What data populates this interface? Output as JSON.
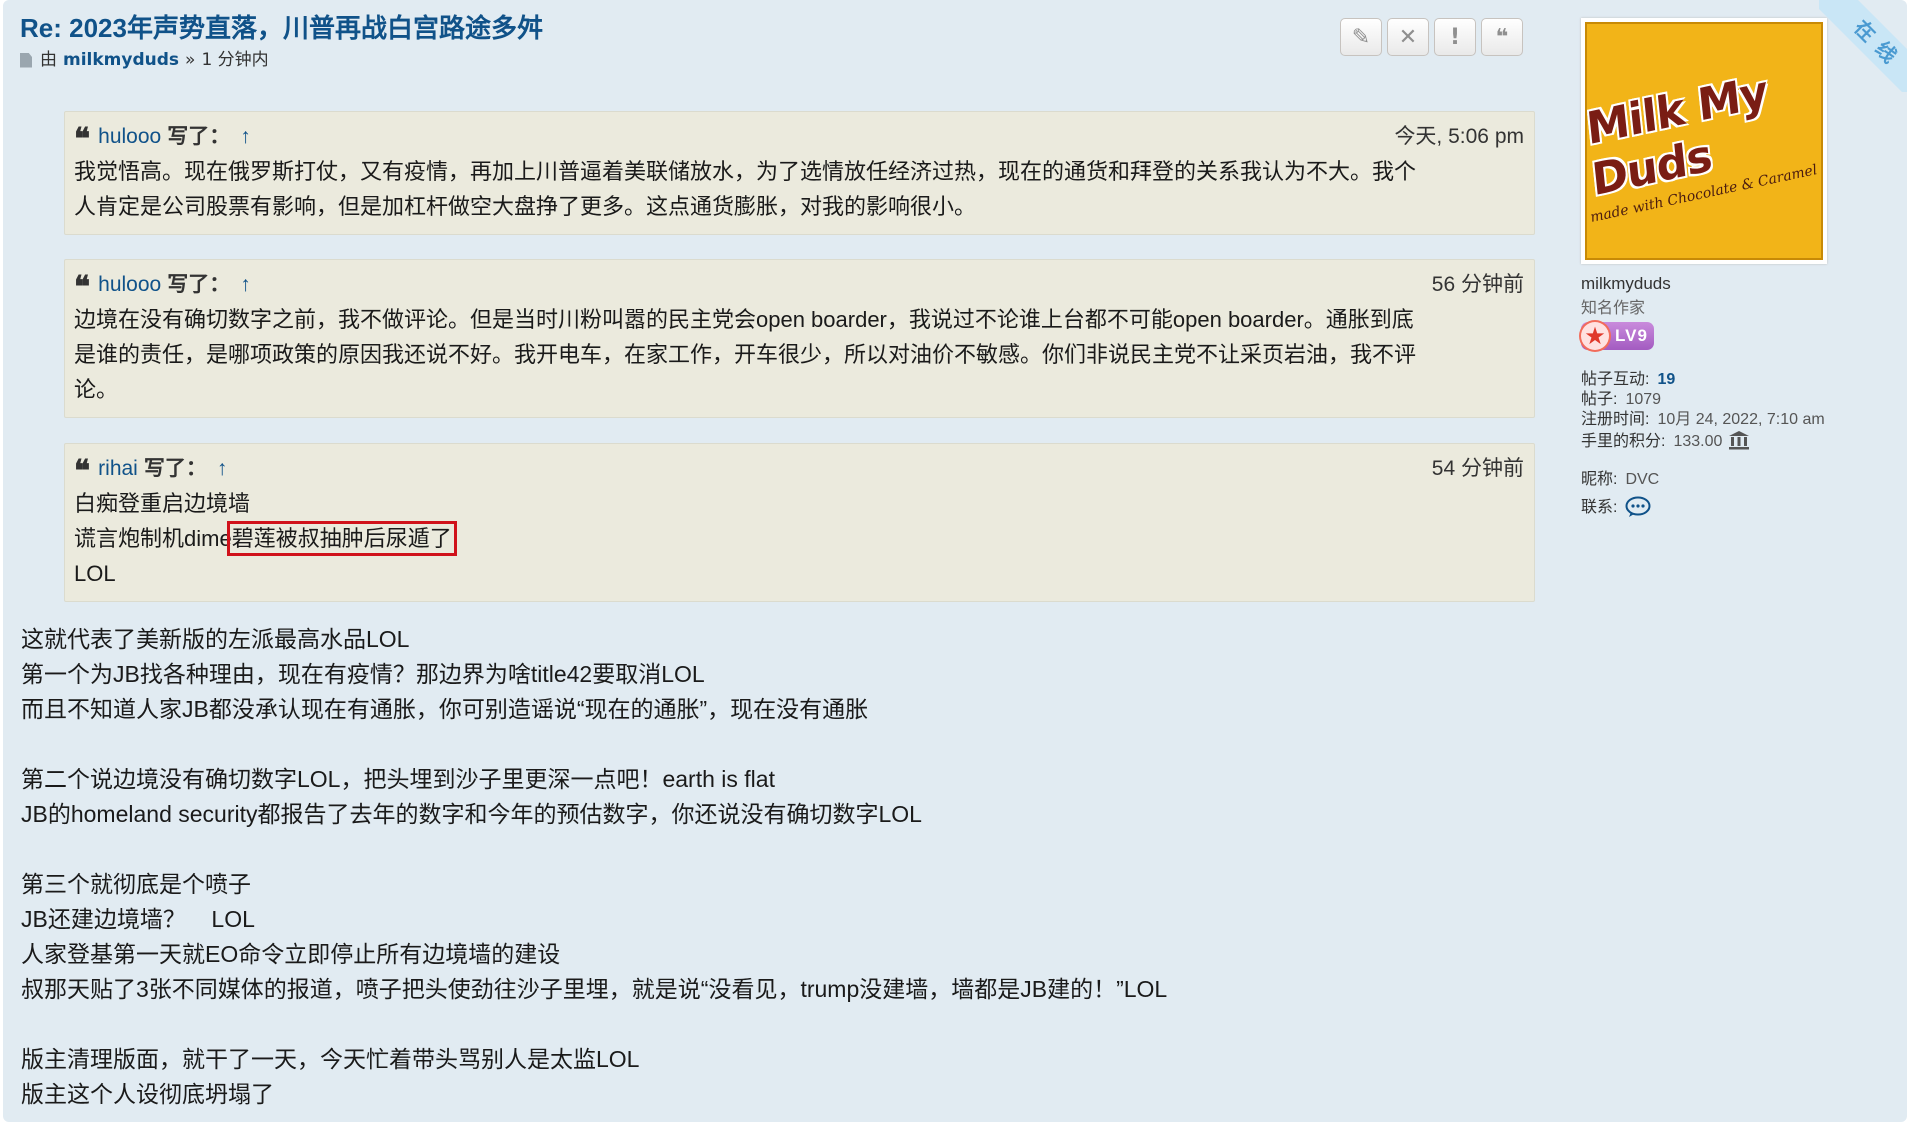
{
  "post": {
    "title": "Re: 2023年声势直落，川普再战白宫路途多舛",
    "by_label": "由",
    "author": "milkmyduds",
    "separator": "»",
    "time": "1 分钟内"
  },
  "toolbar": {
    "edit_icon": "✎",
    "delete_icon": "✕",
    "report_icon": "!",
    "quote_icon": "❝"
  },
  "quotes": [
    {
      "user": "hulooo",
      "wrote": "写了：",
      "arrow": "↑",
      "time": "今天, 5:06 pm",
      "lines": [
        "我觉悟高。现在俄罗斯打仗，又有疫情，再加上川普逼着美联储放水，为了选情放任经济过热，现在的通货和拜登的关系我认为不大。我个",
        "人肯定是公司股票有影响，但是加杠杆做空大盘挣了更多。这点通货膨胀，对我的影响很小。"
      ]
    },
    {
      "user": "hulooo",
      "wrote": "写了：",
      "arrow": "↑",
      "time": "56 分钟前",
      "lines": [
        "边境在没有确切数字之前，我不做评论。但是当时川粉叫嚣的民主党会open boarder，我说过不论谁上台都不可能open boarder。通胀到底",
        "是谁的责任，是哪项政策的原因我还说不好。我开电车，在家工作，开车很少，所以对油价不敏感。你们非说民主党不让采页岩油，我不评",
        "论。"
      ]
    },
    {
      "user": "rihai",
      "wrote": "写了：",
      "arrow": "↑",
      "time": "54 分钟前",
      "line1": "白痴登重启边境墙",
      "line2_prefix": "谎言炮制机dime",
      "line2_highlight": "碧莲被叔抽肿后尿遁了",
      "line3": "LOL"
    }
  ],
  "body_lines": [
    "这就代表了美新版的左派最高水品LOL",
    "第一个为JB找各种理由，现在有疫情？那边界为啥title42要取消LOL",
    "而且不知道人家JB都没承认现在有通胀，你可别造谣说“现在的通胀”，现在没有通胀",
    "",
    "第二个说边境没有确切数字LOL，把头埋到沙子里更深一点吧！earth is flat",
    "JB的homeland security都报告了去年的数字和今年的预估数字，你还说没有确切数字LOL",
    "",
    "第三个就彻底是个喷子",
    "JB还建边境墙？    LOL",
    "人家登基第一天就EO命令立即停止所有边境墙的建设",
    "叔那天贴了3张不同媒体的报道，喷子把头使劲往沙子里埋，就是说“没看见，trump没建墙，墙都是JB建的！”LOL",
    "",
    "版主清理版面，就干了一天，今天忙着带头骂别人是太监LOL",
    "版主这个人设彻底坍塌了"
  ],
  "profile": {
    "avatar_brand": "Milk My Duds",
    "avatar_tagline": "made with Chocolate & Caramel",
    "username": "milkmyduds",
    "rank": "知名作家",
    "level_badge": "LV9",
    "stats": [
      {
        "label": "帖子互动:",
        "value": "19"
      },
      {
        "label": "帖子:",
        "value": "1079"
      },
      {
        "label": "注册时间:",
        "value": "10月 24, 2022, 7:10 am"
      },
      {
        "label": "手里的积分:",
        "value": "133.00"
      }
    ],
    "nickname_label": "昵称:",
    "nickname": "DVC",
    "contact_label": "联系:",
    "online_label": "在线"
  },
  "colors": {
    "post_bg": "#e1ebf2",
    "quote_bg": "#ebeadd",
    "link": "#105289",
    "highlight_box": "#d0121b"
  }
}
